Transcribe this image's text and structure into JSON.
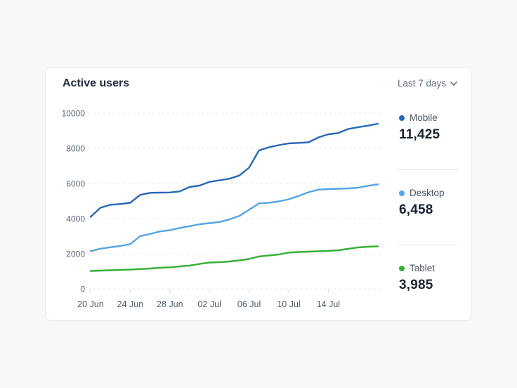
{
  "header": {
    "dropdown_label": "Last 7 days"
  },
  "chart_data": {
    "type": "line",
    "title": "Active users",
    "x_tick_labels": [
      "20 Jun",
      "24 Jun",
      "28 Jun",
      "02 Jul",
      "06 Jul",
      "10 Jul",
      "14 Jul"
    ],
    "x_tick_every": 4,
    "y_ticks": [
      0,
      2000,
      4000,
      6000,
      8000,
      10000
    ],
    "ylim": [
      0,
      10000
    ],
    "grid": "horizontal-dashed",
    "legend_position": "right",
    "series": [
      {
        "name": "Mobile",
        "color": "#2767b7",
        "values": [
          4100,
          4620,
          4790,
          4830,
          4900,
          5350,
          5470,
          5480,
          5490,
          5550,
          5800,
          5880,
          6090,
          6180,
          6270,
          6450,
          6900,
          7880,
          8060,
          8180,
          8280,
          8310,
          8340,
          8620,
          8800,
          8870,
          9100,
          9200,
          9290,
          9400
        ]
      },
      {
        "name": "Desktop",
        "color": "#54a4e6",
        "values": [
          2150,
          2290,
          2370,
          2440,
          2550,
          3000,
          3130,
          3270,
          3340,
          3470,
          3570,
          3680,
          3740,
          3810,
          3950,
          4150,
          4500,
          4870,
          4900,
          4980,
          5100,
          5290,
          5500,
          5650,
          5680,
          5700,
          5720,
          5760,
          5870,
          5950
        ]
      },
      {
        "name": "Tablet",
        "color": "#35af35",
        "values": [
          1020,
          1040,
          1060,
          1080,
          1100,
          1130,
          1160,
          1200,
          1230,
          1280,
          1330,
          1420,
          1500,
          1520,
          1560,
          1620,
          1700,
          1850,
          1900,
          1960,
          2070,
          2100,
          2120,
          2140,
          2160,
          2200,
          2280,
          2360,
          2400,
          2420
        ]
      }
    ]
  },
  "legend": {
    "items": [
      {
        "label": "Mobile",
        "value": "11,425"
      },
      {
        "label": "Desktop",
        "value": "6,458"
      },
      {
        "label": "Tablet",
        "value": "3,985"
      }
    ]
  },
  "colors": {
    "grid": "#e3e5e9",
    "tick": "#d9dce0",
    "axis_text": "#5a6372",
    "title_text": "#212b3b",
    "value_text": "#1a2230",
    "label_text": "#4b5462",
    "dropdown_text": "#5f6b7a",
    "divider": "#e7e9ec",
    "card_border": "#e9ebee",
    "page_background": "#f7f8fa"
  }
}
